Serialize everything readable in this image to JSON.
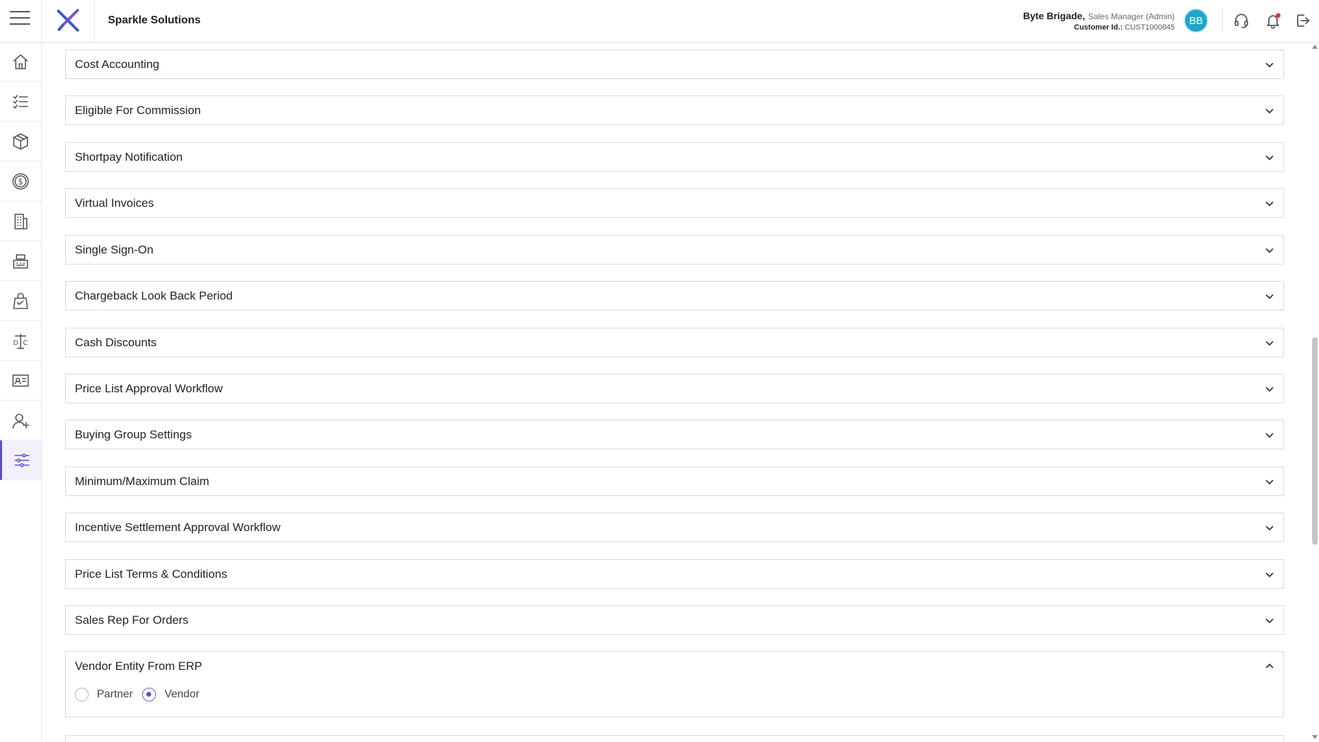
{
  "header": {
    "company_name": "Sparkle Solutions",
    "user_name": "Byte Brigade,",
    "user_role": "Sales Manager (Admin)",
    "customer_id_label": "Customer Id.:",
    "customer_id": "CUST1000845",
    "avatar_initials": "BB",
    "accent_color": "#1ea7c9"
  },
  "sidebar": {
    "active_color": "#5a4fcf",
    "items": [
      {
        "icon": "home-icon"
      },
      {
        "icon": "checklist-icon"
      },
      {
        "icon": "box-icon"
      },
      {
        "icon": "dollar-coin-icon"
      },
      {
        "icon": "building-icon"
      },
      {
        "icon": "cash-register-icon"
      },
      {
        "icon": "shopping-bag-icon"
      },
      {
        "icon": "scale-dc-icon"
      },
      {
        "icon": "id-card-icon"
      },
      {
        "icon": "add-user-icon"
      },
      {
        "icon": "settings-sliders-icon",
        "active": true
      }
    ]
  },
  "panels": [
    {
      "title": "Cost Accounting"
    },
    {
      "title": "Eligible For Commission"
    },
    {
      "title": "Shortpay Notification"
    },
    {
      "title": "Virtual Invoices"
    },
    {
      "title": "Single Sign-On"
    },
    {
      "title": "Chargeback Look Back Period"
    },
    {
      "title": "Cash Discounts"
    },
    {
      "title": "Price List Approval Workflow"
    },
    {
      "title": "Buying Group Settings"
    },
    {
      "title": "Minimum/Maximum Claim"
    },
    {
      "title": "Incentive Settlement Approval Workflow"
    },
    {
      "title": "Price List Terms & Conditions"
    },
    {
      "title": "Sales Rep For Orders"
    },
    {
      "title": "Vendor Entity From ERP",
      "expanded": true,
      "options": [
        {
          "label": "Partner",
          "selected": false
        },
        {
          "label": "Vendor",
          "selected": true
        }
      ]
    }
  ]
}
